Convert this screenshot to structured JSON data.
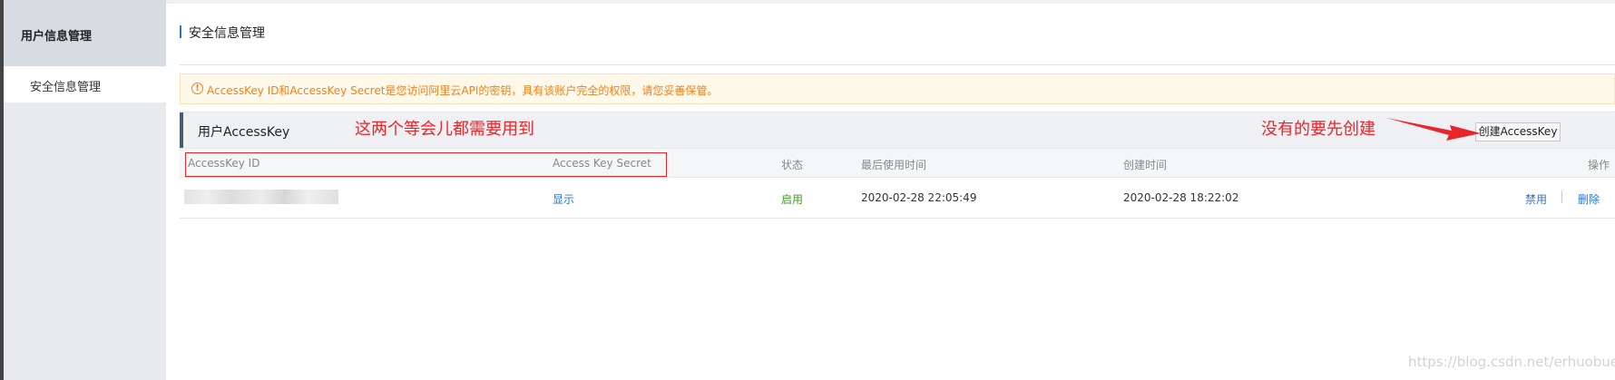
{
  "sidebar": {
    "header": "用户信息管理",
    "items": [
      {
        "label": "安全信息管理",
        "active": true
      }
    ]
  },
  "page": {
    "title": "安全信息管理"
  },
  "notice": {
    "icon": "exclamation-icon",
    "text": "AccessKey ID和AccessKey Secret是您访问阿里云API的密钥，具有该账户完全的权限，请您妥善保管。"
  },
  "panel": {
    "title": "用户AccessKey",
    "create_button": "创建AccessKey"
  },
  "annotations": {
    "left": "这两个等会儿都需要用到",
    "right": "没有的要先创建"
  },
  "table": {
    "columns": [
      "AccessKey ID",
      "Access Key Secret",
      "状态",
      "最后使用时间",
      "创建时间",
      "操作"
    ],
    "rows": [
      {
        "access_key_id": "",
        "secret_action": "显示",
        "status": "启用",
        "last_used": "2020-02-28 22:05:49",
        "created": "2020-02-28 18:22:02",
        "actions": [
          "禁用",
          "删除"
        ]
      }
    ]
  },
  "watermark": "https://blog.csdn.net/erhuobuer",
  "colors": {
    "link": "#2a74d6",
    "status_enabled": "#3aa11e",
    "annotation": "#e8262a",
    "notice_text": "#f0801a"
  }
}
